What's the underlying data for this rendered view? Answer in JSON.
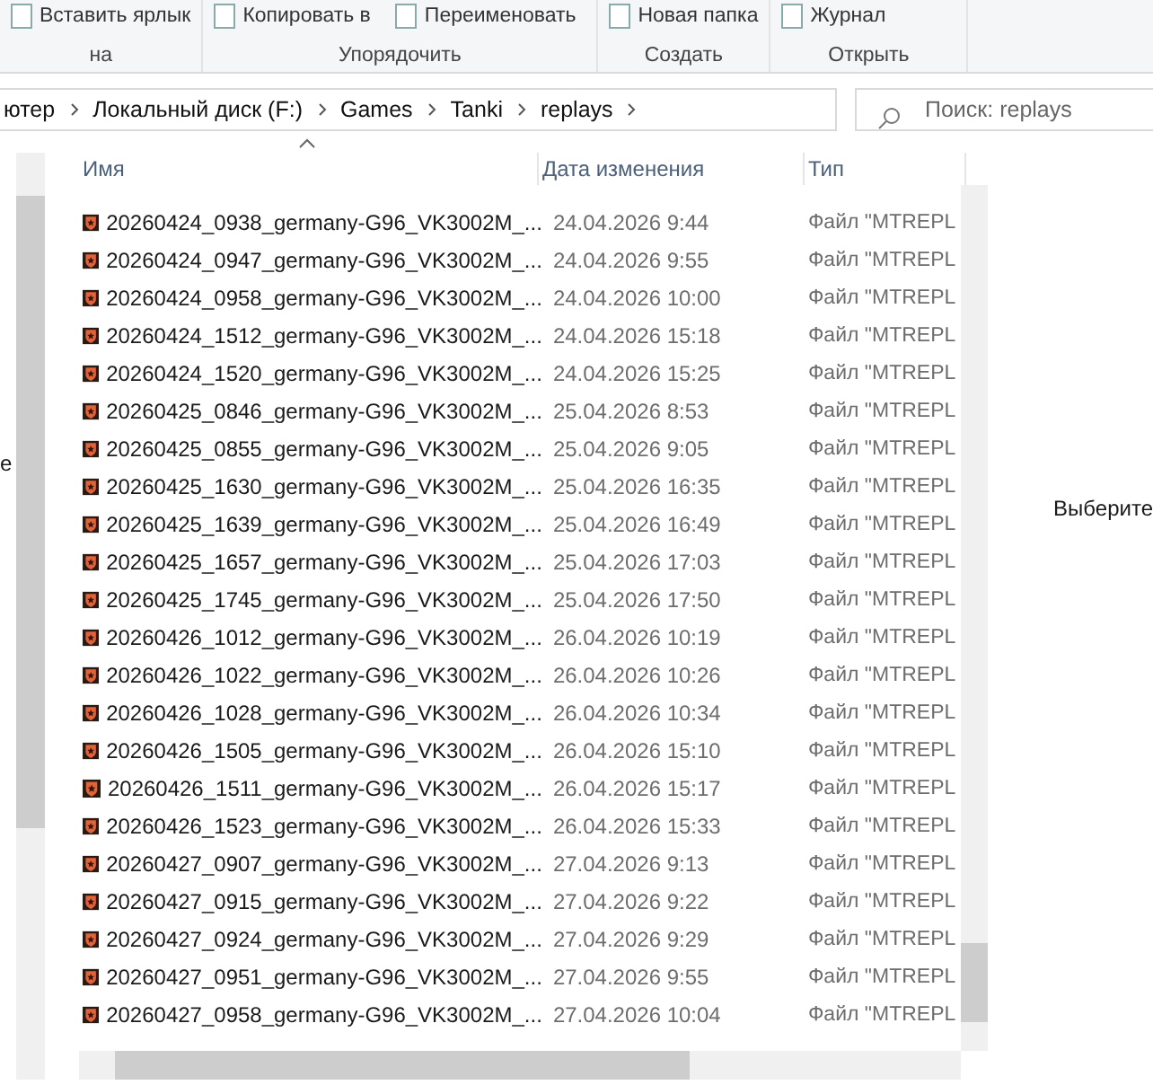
{
  "ribbon": {
    "groups": [
      {
        "label": "на",
        "buttons": [
          "Вставить ярлык"
        ]
      },
      {
        "label": "Упорядочить",
        "buttons": [
          "Копировать в",
          "Переименовать"
        ]
      },
      {
        "label": "Создать",
        "buttons": [
          "Новая папка"
        ]
      },
      {
        "label": "Открыть",
        "buttons": [
          "Журнал"
        ]
      }
    ]
  },
  "address_bar": {
    "crumbs": [
      "ютер",
      "Локальный диск (F:)",
      "Games",
      "Tanki",
      "replays"
    ]
  },
  "search": {
    "placeholder": "Поиск: replays"
  },
  "navigation_pane": {
    "partial_text": "е"
  },
  "table": {
    "columns": [
      "Имя",
      "Дата изменения",
      "Тип"
    ],
    "rows": [
      {
        "name": "20260424_0938_germany-G96_VK3002M_...",
        "date": "24.04.2026 9:44",
        "type": "Файл \"MTREPL"
      },
      {
        "name": "20260424_0947_germany-G96_VK3002M_...",
        "date": "24.04.2026 9:55",
        "type": "Файл \"MTREPL"
      },
      {
        "name": "20260424_0958_germany-G96_VK3002M_...",
        "date": "24.04.2026 10:00",
        "type": "Файл \"MTREPL"
      },
      {
        "name": "20260424_1512_germany-G96_VK3002M_...",
        "date": "24.04.2026 15:18",
        "type": "Файл \"MTREPL"
      },
      {
        "name": "20260424_1520_germany-G96_VK3002M_...",
        "date": "24.04.2026 15:25",
        "type": "Файл \"MTREPL"
      },
      {
        "name": "20260425_0846_germany-G96_VK3002M_...",
        "date": "25.04.2026 8:53",
        "type": "Файл \"MTREPL"
      },
      {
        "name": "20260425_0855_germany-G96_VK3002M_...",
        "date": "25.04.2026 9:05",
        "type": "Файл \"MTREPL"
      },
      {
        "name": "20260425_1630_germany-G96_VK3002M_...",
        "date": "25.04.2026 16:35",
        "type": "Файл \"MTREPL"
      },
      {
        "name": "20260425_1639_germany-G96_VK3002M_...",
        "date": "25.04.2026 16:49",
        "type": "Файл \"MTREPL"
      },
      {
        "name": "20260425_1657_germany-G96_VK3002M_...",
        "date": "25.04.2026 17:03",
        "type": "Файл \"MTREPL"
      },
      {
        "name": "20260425_1745_germany-G96_VK3002M_...",
        "date": "25.04.2026 17:50",
        "type": "Файл \"MTREPL"
      },
      {
        "name": "20260426_1012_germany-G96_VK3002M_...",
        "date": "26.04.2026 10:19",
        "type": "Файл \"MTREPL"
      },
      {
        "name": "20260426_1022_germany-G96_VK3002M_...",
        "date": "26.04.2026 10:26",
        "type": "Файл \"MTREPL"
      },
      {
        "name": "20260426_1028_germany-G96_VK3002M_...",
        "date": "26.04.2026 10:34",
        "type": "Файл \"MTREPL"
      },
      {
        "name": "20260426_1505_germany-G96_VK3002M_...",
        "date": "26.04.2026 15:10",
        "type": "Файл \"MTREPL"
      },
      {
        "name": "20260426_1511_germany-G96_VK3002M_...",
        "date": "26.04.2026 15:17",
        "type": "Файл \"MTREPL"
      },
      {
        "name": "20260426_1523_germany-G96_VK3002M_...",
        "date": "26.04.2026 15:33",
        "type": "Файл \"MTREPL"
      },
      {
        "name": "20260427_0907_germany-G96_VK3002M_...",
        "date": "27.04.2026 9:13",
        "type": "Файл \"MTREPL"
      },
      {
        "name": "20260427_0915_germany-G96_VK3002M_...",
        "date": "27.04.2026 9:22",
        "type": "Файл \"MTREPL"
      },
      {
        "name": "20260427_0924_germany-G96_VK3002M_...",
        "date": "27.04.2026 9:29",
        "type": "Файл \"MTREPL"
      },
      {
        "name": "20260427_0951_germany-G96_VK3002M_...",
        "date": "27.04.2026 9:55",
        "type": "Файл \"MTREPL"
      },
      {
        "name": "20260427_0958_germany-G96_VK3002M_...",
        "date": "27.04.2026 10:04",
        "type": "Файл \"MTREPL"
      }
    ]
  },
  "details_pane": {
    "text": "Выберите"
  }
}
